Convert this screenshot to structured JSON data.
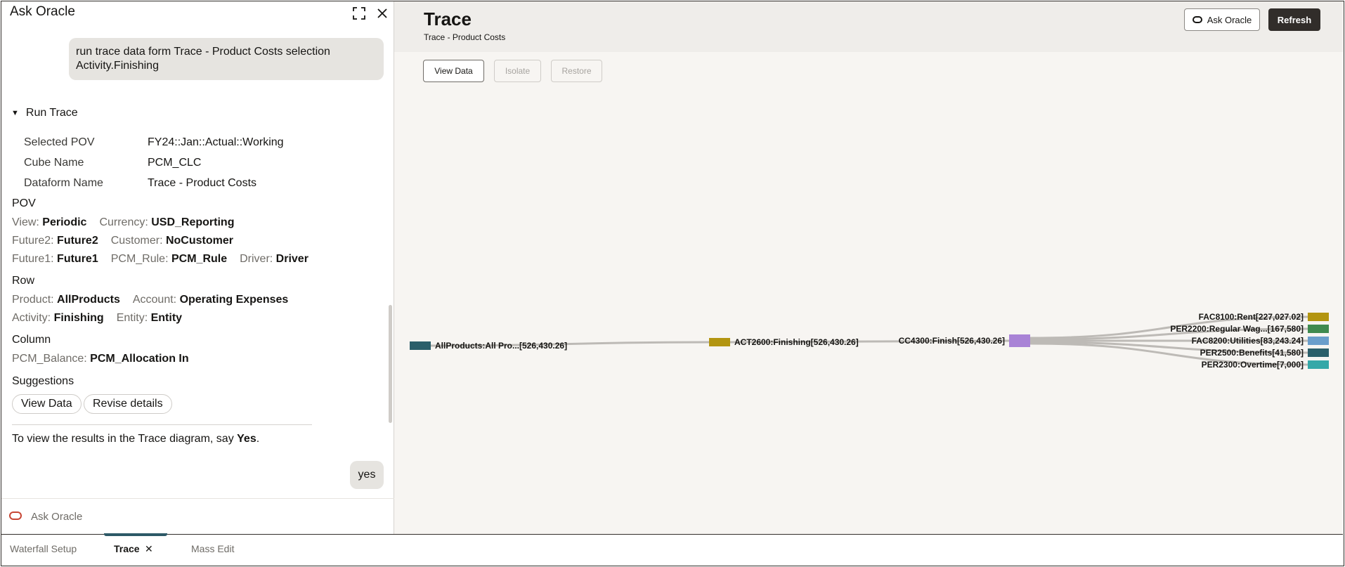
{
  "chat": {
    "title": "Ask Oracle",
    "expand_icon": "expand-icon",
    "close_icon": "close-icon",
    "user_message_1": "run trace data form Trace - Product Costs selection Activity.Finishing",
    "run_trace": {
      "heading": "Run Trace",
      "fields": [
        {
          "label": "Selected POV",
          "value": "FY24::Jan::Actual::Working"
        },
        {
          "label": "Cube Name",
          "value": "PCM_CLC"
        },
        {
          "label": "Dataform Name",
          "value": "Trace - Product Costs"
        }
      ]
    },
    "pov": {
      "heading": "POV",
      "view_label": "View:",
      "view_value": "Periodic",
      "currency_label": "Currency:",
      "currency_value": "USD_Reporting",
      "future2_label": "Future2:",
      "future2_value": "Future2",
      "customer_label": "Customer:",
      "customer_value": "NoCustomer",
      "future1_label": "Future1:",
      "future1_value": "Future1",
      "pcm_rule_label": "PCM_Rule:",
      "pcm_rule_value": "PCM_Rule",
      "driver_label": "Driver:",
      "driver_value": "Driver"
    },
    "row": {
      "heading": "Row",
      "product_label": "Product:",
      "product_value": "AllProducts",
      "account_label": "Account:",
      "account_value": "Operating Expenses",
      "activity_label": "Activity:",
      "activity_value": "Finishing",
      "entity_label": "Entity:",
      "entity_value": "Entity"
    },
    "column": {
      "heading": "Column",
      "balance_label": "PCM_Balance:",
      "balance_value": "PCM_Allocation In"
    },
    "suggestions": {
      "heading": "Suggestions",
      "chips": [
        "View Data",
        "Revise details"
      ]
    },
    "prompt_prefix": "To view the results in the Trace diagram, say ",
    "prompt_keyword": "Yes",
    "prompt_suffix": ".",
    "user_message_2": "yes",
    "input_placeholder": "Ask Oracle",
    "input_icon": "oracle-icon"
  },
  "trace": {
    "title": "Trace",
    "subtitle": "Trace - Product Costs",
    "ask_oracle_label": "Ask Oracle",
    "ask_oracle_icon": "oracle-icon",
    "refresh_label": "Refresh",
    "toolbar": {
      "view_data_label": "View Data",
      "isolate_label": "Isolate",
      "restore_label": "Restore"
    },
    "nodes": [
      {
        "id": "allproducts",
        "label": "AllProducts:All Pro...[526,430.26]",
        "color": "#2b5f6a"
      },
      {
        "id": "act2600",
        "label": "ACT2600:Finishing[526,430.26]",
        "color": "#b39511"
      },
      {
        "id": "cc4300",
        "label": "CC4300:Finish[526,430.26]",
        "color": "#a983d6"
      },
      {
        "id": "fac8100",
        "label": "FAC8100:Rent[227,027.02]",
        "color": "#b39511"
      },
      {
        "id": "per2200",
        "label": "PER2200:Regular Wag...[167,580]",
        "color": "#3f8a4f"
      },
      {
        "id": "fac8200",
        "label": "FAC8200:Utilities[83,243.24]",
        "color": "#6a9ecb"
      },
      {
        "id": "per2500",
        "label": "PER2500:Benefits[41,580]",
        "color": "#2b5f6a"
      },
      {
        "id": "per2300",
        "label": "PER2300:Overtime[7,000]",
        "color": "#35a8a8"
      }
    ]
  },
  "tabs": {
    "waterfall": "Waterfall Setup",
    "trace": "Trace",
    "trace_close": "✕",
    "mass_edit": "Mass Edit"
  },
  "colors": {
    "accent_dark": "#312d2a",
    "oracle_red": "#c74634",
    "tab_indicator": "#2d5967"
  }
}
